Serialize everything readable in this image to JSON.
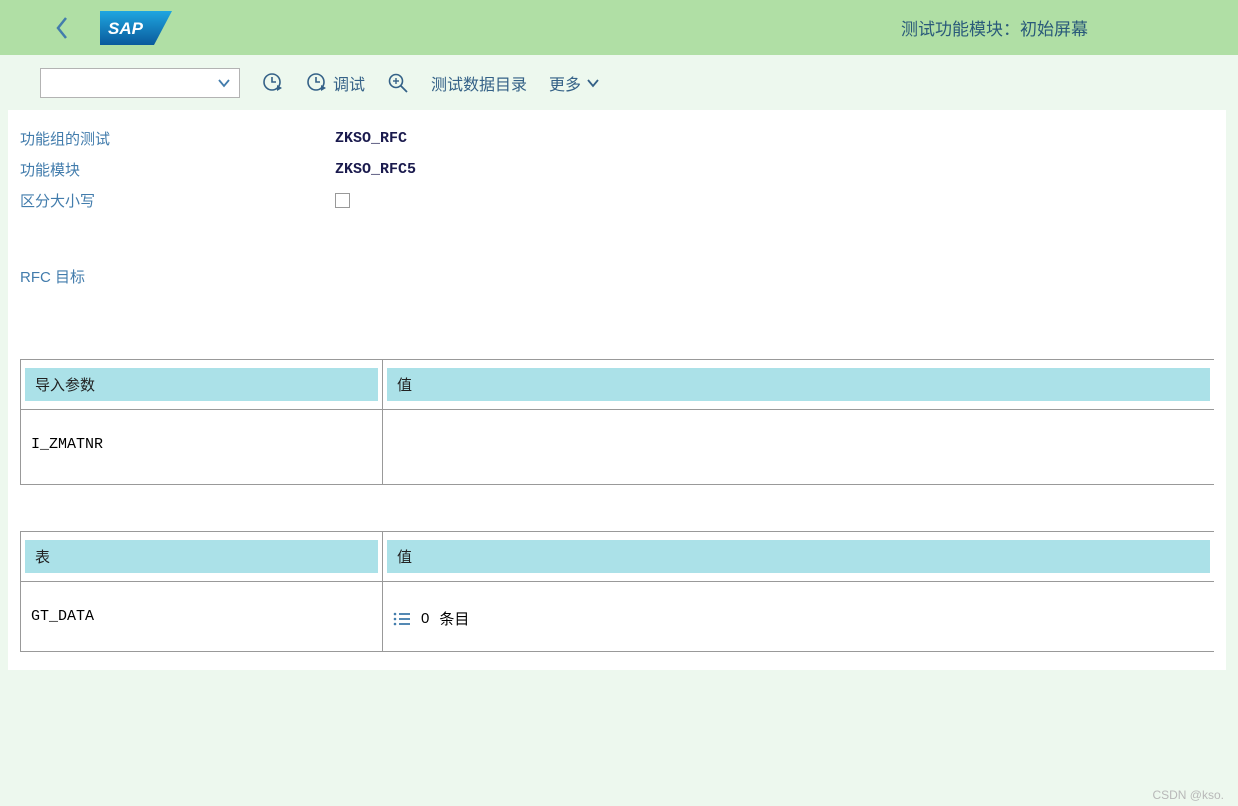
{
  "header": {
    "title": "测试功能模块：初始屏幕"
  },
  "toolbar": {
    "debug": "调试",
    "test_data_dir": "测试数据目录",
    "more": "更多"
  },
  "form": {
    "function_group_test_label": "功能组的测试",
    "function_group_test_value": "ZKSO_RFC",
    "function_module_label": "功能模块",
    "function_module_value": "ZKSO_RFC5",
    "case_sensitive_label": "区分大小写",
    "rfc_target_label": "RFC 目标",
    "rfc_target_value": ""
  },
  "import_table": {
    "header_param": "导入参数",
    "header_value": "值",
    "rows": [
      {
        "param": "I_ZMATNR",
        "value": ""
      }
    ]
  },
  "tables_table": {
    "header_param": "表",
    "header_value": "值",
    "rows": [
      {
        "param": "GT_DATA",
        "count": "0",
        "suffix": "条目"
      }
    ]
  },
  "watermark": "CSDN @kso."
}
